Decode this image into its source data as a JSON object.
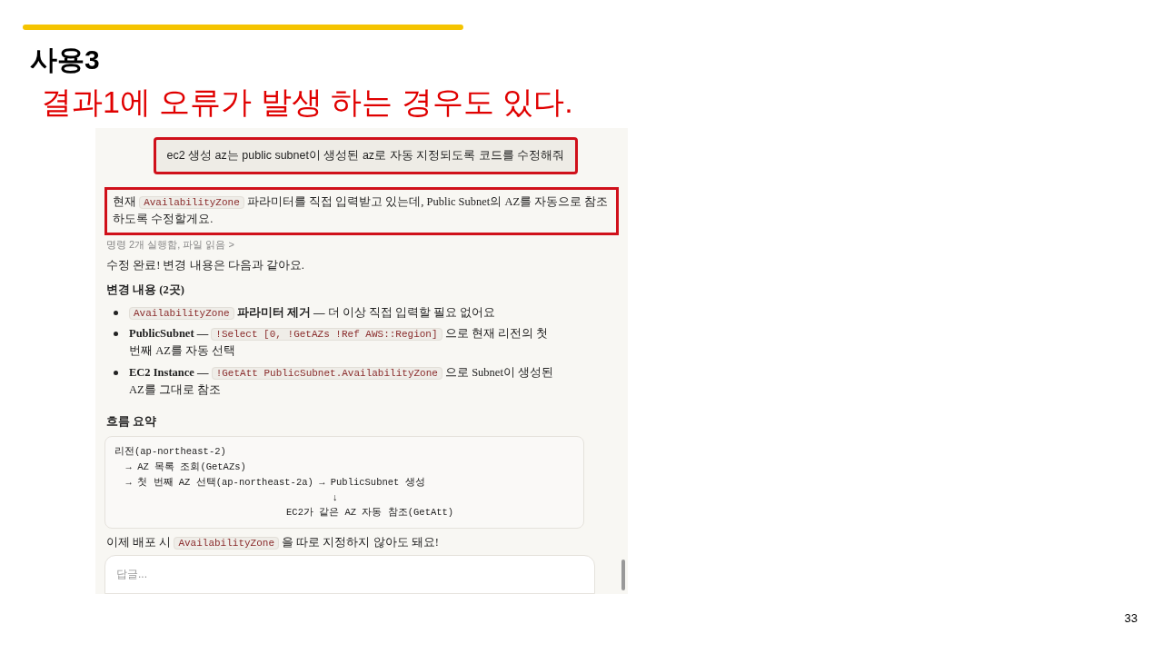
{
  "slide": {
    "title": "사용3",
    "subtitle": "결과1에 오류가 발생 하는 경우도 있다.",
    "page_number": "33"
  },
  "chat": {
    "user_message": {
      "text": "ec2 생성 az는  public subnet이 생성된  az로 자동 지정되도록 코드를 수정해줘",
      "highlighted": true
    },
    "intro": {
      "highlighted": true,
      "segments": [
        {
          "kind": "text",
          "text": "현재 "
        },
        {
          "kind": "code",
          "text": "AvailabilityZone"
        },
        {
          "kind": "text",
          "text": " 파라미터를 직접 입력받고 있는데, Public Subnet의 AZ를 자동으로 참조하도록 수정할게요."
        }
      ]
    },
    "tool_summary": "명령 2개 실행함, 파일 읽음 >",
    "done_text": "수정 완료! 변경 내용은 다음과 같아요.",
    "changes_heading": "변경 내용 (2곳)",
    "bullets": [
      {
        "segments": [
          {
            "kind": "code",
            "text": "AvailabilityZone"
          },
          {
            "kind": "bold",
            "text": " 파라미터 제거 —"
          },
          {
            "kind": "text",
            "text": " 더 이상 직접 입력할 필요 없어요"
          }
        ]
      },
      {
        "segments": [
          {
            "kind": "bold",
            "text": "PublicSubnet — "
          },
          {
            "kind": "code",
            "text": "!Select [0, !GetAZs !Ref AWS::Region]"
          },
          {
            "kind": "text",
            "text": " 으로 현재 리전의 첫 번째 AZ를 자동 선택"
          }
        ]
      },
      {
        "segments": [
          {
            "kind": "bold",
            "text": "EC2 Instance — "
          },
          {
            "kind": "code",
            "text": "!GetAtt PublicSubnet.AvailabilityZone"
          },
          {
            "kind": "text",
            "text": " 으로 Subnet이 생성된 AZ를 그대로 참조"
          }
        ]
      }
    ],
    "flow_heading": "흐름 요약",
    "code_lines": [
      "리전(ap-northeast-2)",
      "  → AZ 목록 조회(GetAZs)",
      "  → 첫 번째 AZ 선택(ap-northeast-2a) → PublicSubnet 생성",
      "                                      ↓",
      "                              EC2가 같은 AZ 자동 참조(GetAtt)"
    ],
    "final": {
      "segments": [
        {
          "kind": "text",
          "text": "이제 배포 시 "
        },
        {
          "kind": "code",
          "text": "AvailabilityZone"
        },
        {
          "kind": "text",
          "text": " 을 따로 지정하지 않아도 돼요!"
        }
      ]
    },
    "reply": {
      "placeholder": "답글..."
    }
  }
}
